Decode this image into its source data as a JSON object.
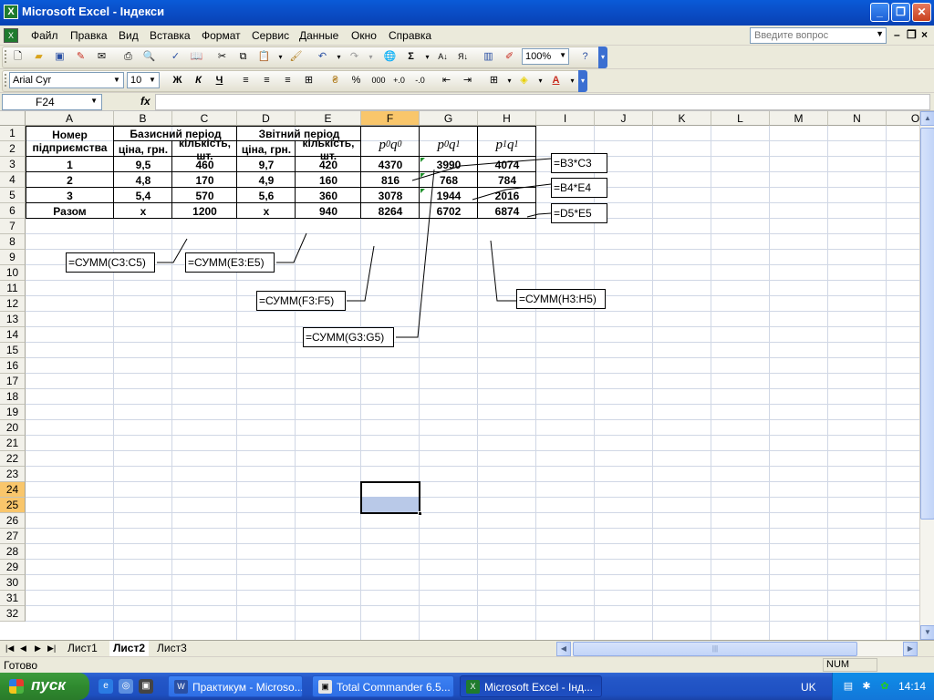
{
  "window": {
    "title": "Microsoft Excel - Індекси"
  },
  "menu": {
    "items": [
      "Файл",
      "Правка",
      "Вид",
      "Вставка",
      "Формат",
      "Сервис",
      "Данные",
      "Окно",
      "Справка"
    ],
    "ask_placeholder": "Введите вопрос"
  },
  "toolbar": {
    "zoom": "100%"
  },
  "format_toolbar": {
    "font": "Arial Cyr",
    "size": "10",
    "bold": "Ж",
    "italic": "К",
    "underline": "Ч",
    "thousands": "000",
    "percent": "%"
  },
  "formula_bar": {
    "name_box": "F24",
    "fx": "fx",
    "value": ""
  },
  "grid": {
    "columns": [
      "A",
      "B",
      "C",
      "D",
      "E",
      "F",
      "G",
      "H",
      "I",
      "J",
      "K",
      "L",
      "M",
      "N",
      "O"
    ],
    "rows": [
      "1",
      "2",
      "3",
      "4",
      "5",
      "6",
      "7",
      "8",
      "9",
      "10",
      "11",
      "12",
      "13",
      "14",
      "15",
      "16",
      "17",
      "18",
      "19",
      "20",
      "21",
      "22",
      "23",
      "24",
      "25",
      "26",
      "27",
      "28",
      "29",
      "30",
      "31",
      "32"
    ],
    "selected_cell": "F24"
  },
  "table": {
    "header": {
      "a": "Номер підприємства",
      "base_period": "Базисний період",
      "report_period": "Звітний період",
      "price": "ціна, грн.",
      "quantity": "кількість, шт.",
      "f": "p0q0",
      "g": "p0q1",
      "h": "p1q1"
    },
    "rows": [
      {
        "a": "1",
        "b": "9,5",
        "c": "460",
        "d": "9,7",
        "e": "420",
        "f": "4370",
        "g": "3990",
        "h": "4074"
      },
      {
        "a": "2",
        "b": "4,8",
        "c": "170",
        "d": "4,9",
        "e": "160",
        "f": "816",
        "g": "768",
        "h": "784"
      },
      {
        "a": "3",
        "b": "5,4",
        "c": "570",
        "d": "5,6",
        "e": "360",
        "f": "3078",
        "g": "1944",
        "h": "2016"
      },
      {
        "a": "Разом",
        "b": "x",
        "c": "1200",
        "d": "x",
        "e": "940",
        "f": "8264",
        "g": "6702",
        "h": "6874"
      }
    ]
  },
  "callouts": {
    "b3c3": "=B3*C3",
    "b4e4": "=B4*E4",
    "d5e5": "=D5*E5",
    "sum_c": "=СУММ(C3:C5)",
    "sum_e": "=СУММ(E3:E5)",
    "sum_f": "=СУММ(F3:F5)",
    "sum_g": "=СУММ(G3:G5)",
    "sum_h": "=СУММ(H3:H5)"
  },
  "sheets": [
    "Лист1",
    "Лист2",
    "Лист3"
  ],
  "active_sheet": "Лист2",
  "status": {
    "text": "Готово",
    "num": "NUM"
  },
  "taskbar": {
    "start": "пуск",
    "tasks": [
      "Практикум - Microso...",
      "Total Commander 6.5...",
      "Microsoft Excel - Інд..."
    ],
    "lang": "UK",
    "clock": "14:14"
  }
}
